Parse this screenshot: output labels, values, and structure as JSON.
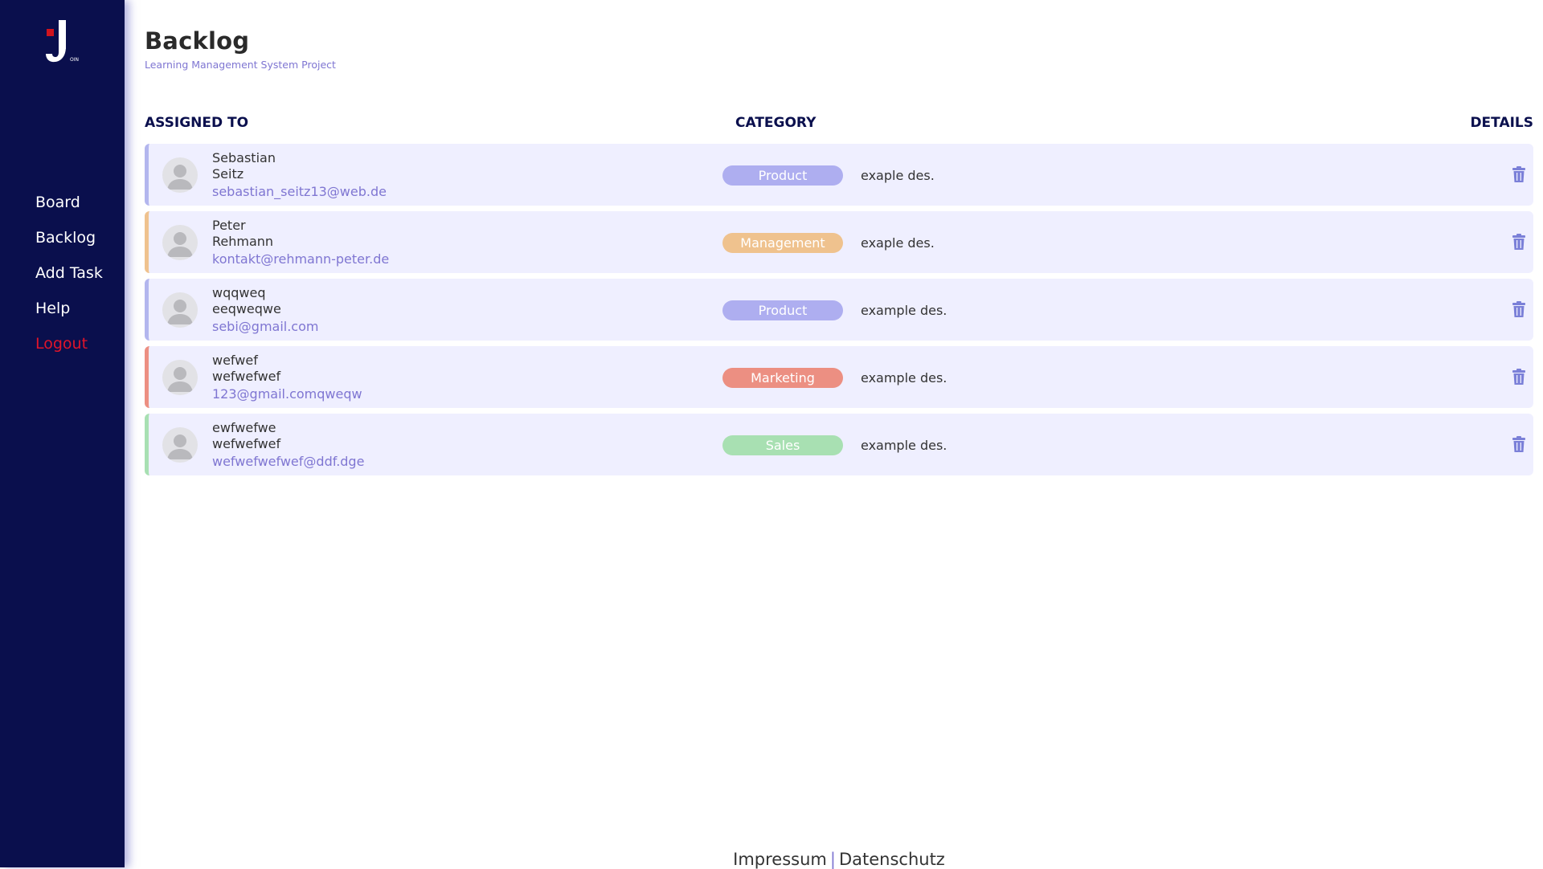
{
  "app": {
    "logo_text": "J",
    "logo_subtext": "OIN"
  },
  "nav": [
    {
      "label": "Board"
    },
    {
      "label": "Backlog"
    },
    {
      "label": "Add Task"
    },
    {
      "label": "Help"
    },
    {
      "label": "Logout"
    }
  ],
  "page": {
    "title": "Backlog",
    "subtitle": "Learning Management System Project"
  },
  "table": {
    "headers": {
      "assigned": "ASSIGNED TO",
      "category": "CATEGORY",
      "details": "DETAILS"
    },
    "rows": [
      {
        "first": "Sebastian",
        "last": "Seitz",
        "email": "sebastian_seitz13@web.de",
        "category": "Product",
        "category_color": "#aeaef0",
        "desc": "exaple des.",
        "stripe_color": "#b3b6ee"
      },
      {
        "first": "Peter",
        "last": "Rehmann",
        "email": "kontakt@rehmann-peter.de",
        "category": "Management",
        "category_color": "#efc28e",
        "desc": "exaple des.",
        "stripe_color": "#efc28e"
      },
      {
        "first": "wqqweq",
        "last": "eeqweqwe",
        "email": "sebi@gmail.com",
        "category": "Product",
        "category_color": "#aeaef0",
        "desc": "example des.",
        "stripe_color": "#b3b6ee"
      },
      {
        "first": "wefwef",
        "last": "wefwefwef",
        "email": "123@gmail.comqweqw",
        "category": "Marketing",
        "category_color": "#ec8f82",
        "desc": "example des.",
        "stripe_color": "#ec8f82"
      },
      {
        "first": "ewfwefwe",
        "last": "wefwefwef",
        "email": "wefwefwefwef@ddf.dge",
        "category": "Sales",
        "category_color": "#a8e0b2",
        "desc": "example des.",
        "stripe_color": "#a8e0b2"
      }
    ]
  },
  "footer": {
    "impressum": "Impressum",
    "separator": "|",
    "datenschutz": "Datenschutz"
  },
  "colors": {
    "sidebar": "#0a0f4d",
    "accent": "#7f76d2",
    "logout": "#e0142a",
    "row_bg": "#efefff"
  }
}
